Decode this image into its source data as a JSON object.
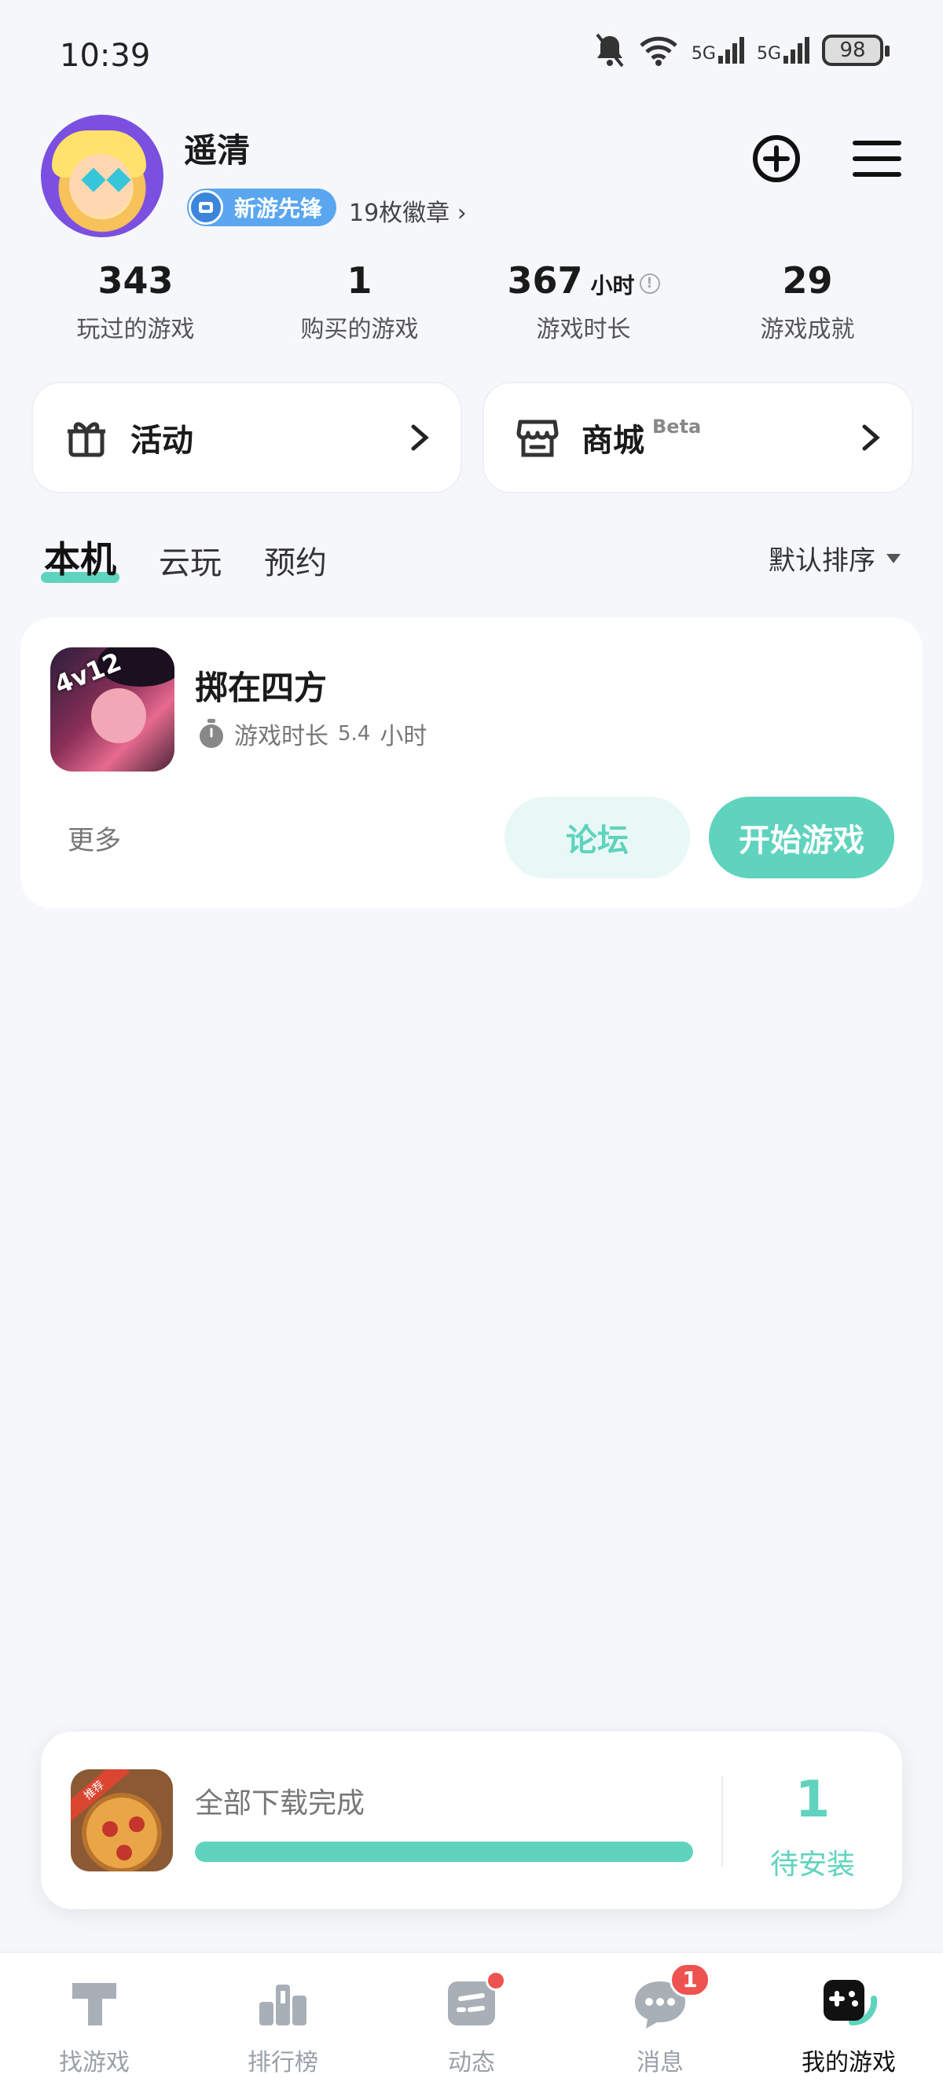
{
  "status_bar": {
    "time": "10:39",
    "battery": "98",
    "signal1": "5G",
    "signal2": "5G"
  },
  "profile": {
    "name": "遥清",
    "badge_label": "新游先锋",
    "badge_count": "19枚徽章",
    "badge_chevron": "›"
  },
  "stats": [
    {
      "value": "343",
      "unit": "",
      "label": "玩过的游戏"
    },
    {
      "value": "1",
      "unit": "",
      "label": "购买的游戏"
    },
    {
      "value": "367",
      "unit": "小时",
      "label": "游戏时长"
    },
    {
      "value": "29",
      "unit": "",
      "label": "游戏成就"
    }
  ],
  "quick_cards": {
    "activity": {
      "label": "活动",
      "icon": "gift-icon"
    },
    "shop": {
      "label": "商城",
      "beta": "Beta",
      "icon": "store-icon"
    }
  },
  "tabs": [
    {
      "label": "本机",
      "active": true
    },
    {
      "label": "云玩",
      "active": false
    },
    {
      "label": "预约",
      "active": false
    }
  ],
  "sort": {
    "label": "默认排序"
  },
  "game": {
    "title": "掷在四方",
    "icon_tag": "4v12",
    "playtime_prefix": "游戏时长",
    "playtime_value": "5.4",
    "playtime_unit": "小时",
    "more_label": "更多",
    "forum_label": "论坛",
    "play_label": "开始游戏"
  },
  "download": {
    "status": "全部下载完成",
    "progress": 1.0,
    "pending_count": "1",
    "pending_label": "待安装",
    "icon_ribbon": "推荐"
  },
  "bottom_nav": [
    {
      "label": "找游戏",
      "icon": "find-games-icon",
      "active": false
    },
    {
      "label": "排行榜",
      "icon": "ranking-icon",
      "active": false
    },
    {
      "label": "动态",
      "icon": "feed-icon",
      "active": false,
      "dot": true
    },
    {
      "label": "消息",
      "icon": "message-icon",
      "active": false,
      "badge": "1"
    },
    {
      "label": "我的游戏",
      "icon": "my-games-icon",
      "active": true
    }
  ],
  "colors": {
    "accent": "#5fd3bd",
    "badge": "#5aa7f0",
    "alert": "#ef5350",
    "background": "#f5f7fa"
  }
}
